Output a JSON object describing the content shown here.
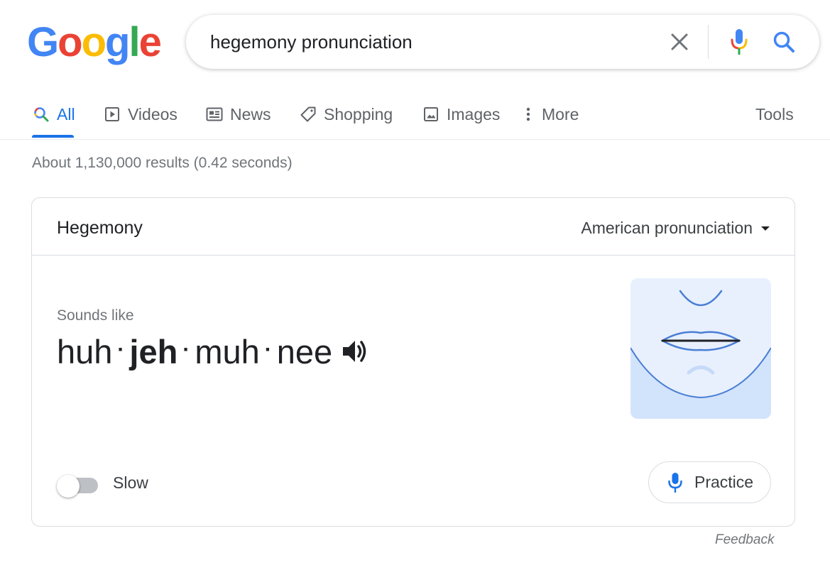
{
  "logo": {
    "letters": [
      "G",
      "o",
      "o",
      "g",
      "l",
      "e"
    ],
    "colors": [
      "#4285F4",
      "#EA4335",
      "#FBBC05",
      "#4285F4",
      "#34A853",
      "#EA4335"
    ]
  },
  "search": {
    "query": "hegemony pronunciation",
    "clear_icon": "close-icon",
    "mic_icon": "microphone-icon",
    "search_icon": "search-icon"
  },
  "tabs": [
    {
      "label": "All",
      "icon": "search-icon",
      "active": true
    },
    {
      "label": "Videos",
      "icon": "play-icon",
      "active": false
    },
    {
      "label": "News",
      "icon": "newspaper-icon",
      "active": false
    },
    {
      "label": "Shopping",
      "icon": "tag-icon",
      "active": false
    },
    {
      "label": "Images",
      "icon": "image-icon",
      "active": false
    },
    {
      "label": "More",
      "icon": "more-vertical-icon",
      "active": false
    }
  ],
  "tools_label": "Tools",
  "result_stats": "About 1,130,000 results (0.42 seconds)",
  "card": {
    "word": "Hegemony",
    "accent": "American pronunciation",
    "sounds_like_label": "Sounds like",
    "syllables": [
      {
        "text": "huh",
        "stressed": false
      },
      {
        "text": "jeh",
        "stressed": true
      },
      {
        "text": "muh",
        "stressed": false
      },
      {
        "text": "nee",
        "stressed": false
      }
    ],
    "separator": "·",
    "speaker_icon": "speaker-icon",
    "mouth_illustration": "mouth-illustration",
    "slow_label": "Slow",
    "slow_enabled": false,
    "practice_label": "Practice"
  },
  "feedback_label": "Feedback",
  "colors": {
    "accent_blue": "#1a73e8",
    "mouth_bg": "#e8f0fe",
    "text_primary": "#202124",
    "text_secondary": "#70757a"
  }
}
